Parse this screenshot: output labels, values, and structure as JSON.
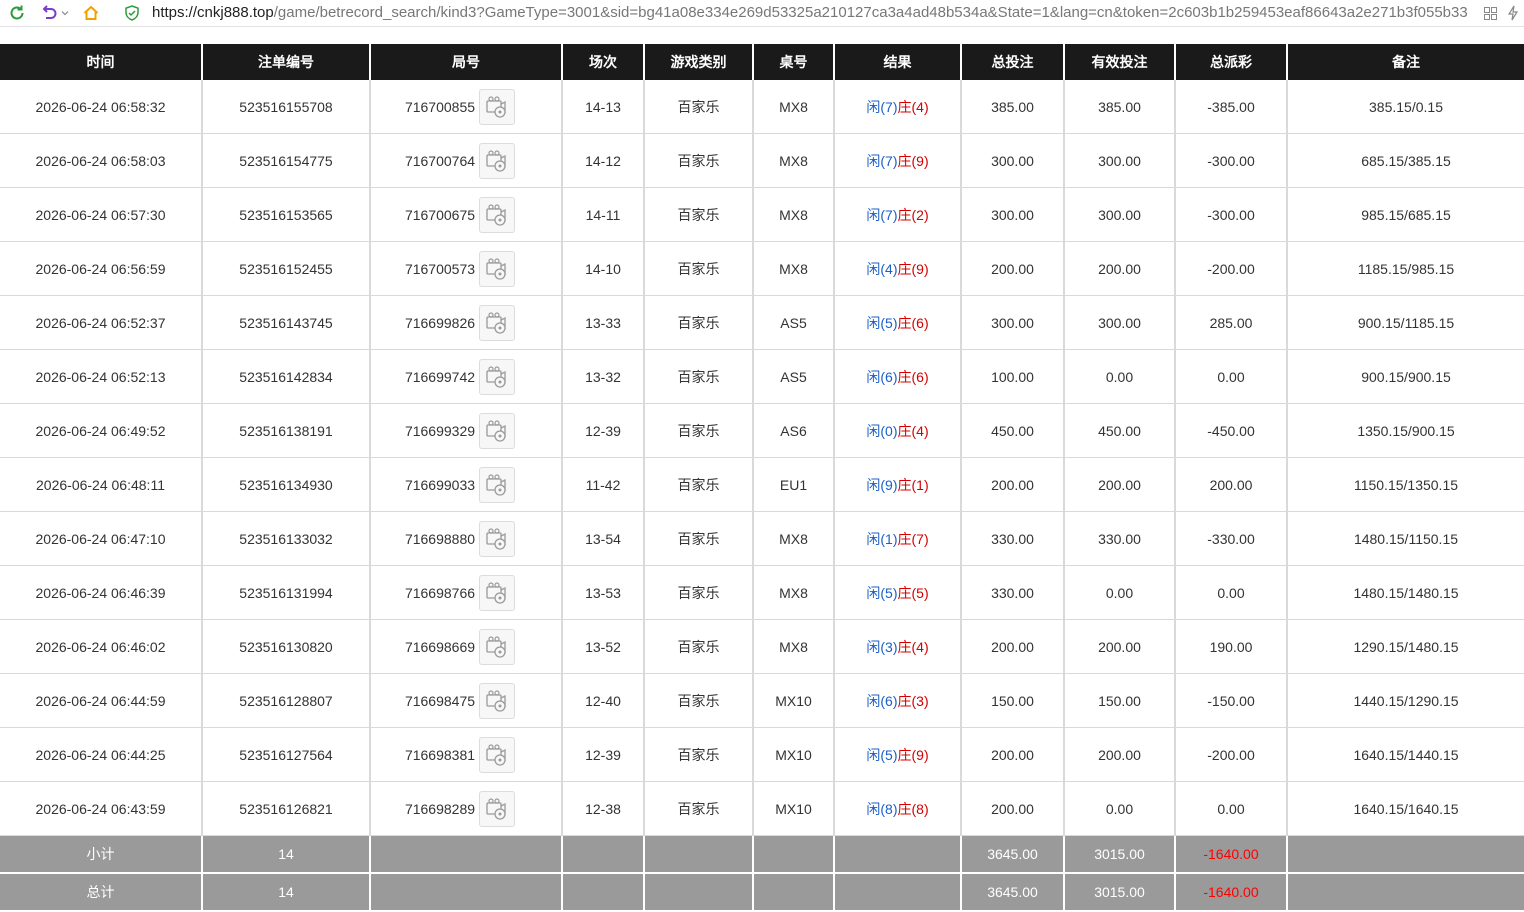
{
  "browser": {
    "url_host": "https://cnkj888.top",
    "url_path": "/game/betrecord_search/kind3?GameType=3001&sid=bg41a08e334e269d53325a210127ca3a4ad48b534a&State=1&lang=cn&token=2c603b1b259453eaf86643a2e271b3f055b33"
  },
  "colors": {
    "header_bg": "#1a1a1a",
    "sum_bg": "#9a9a9a",
    "player": "#1a5fc8",
    "banker": "#d40000",
    "negative": "#e60000"
  },
  "columns": [
    "时间",
    "注单编号",
    "局号",
    "场次",
    "游戏类别",
    "桌号",
    "结果",
    "总投注",
    "有效投注",
    "总派彩",
    "备注"
  ],
  "rows": [
    {
      "time": "2026-06-24 06:58:32",
      "bet_id": "523516155708",
      "round": "716700855",
      "session": "14-13",
      "game": "百家乐",
      "table": "MX8",
      "player": "闲(7)",
      "banker": "庄(4)",
      "total_bet": "385.00",
      "valid_bet": "385.00",
      "payout": "-385.00",
      "remark": "385.15/0.15"
    },
    {
      "time": "2026-06-24 06:58:03",
      "bet_id": "523516154775",
      "round": "716700764",
      "session": "14-12",
      "game": "百家乐",
      "table": "MX8",
      "player": "闲(7)",
      "banker": "庄(9)",
      "total_bet": "300.00",
      "valid_bet": "300.00",
      "payout": "-300.00",
      "remark": "685.15/385.15"
    },
    {
      "time": "2026-06-24 06:57:30",
      "bet_id": "523516153565",
      "round": "716700675",
      "session": "14-11",
      "game": "百家乐",
      "table": "MX8",
      "player": "闲(7)",
      "banker": "庄(2)",
      "total_bet": "300.00",
      "valid_bet": "300.00",
      "payout": "-300.00",
      "remark": "985.15/685.15"
    },
    {
      "time": "2026-06-24 06:56:59",
      "bet_id": "523516152455",
      "round": "716700573",
      "session": "14-10",
      "game": "百家乐",
      "table": "MX8",
      "player": "闲(4)",
      "banker": "庄(9)",
      "total_bet": "200.00",
      "valid_bet": "200.00",
      "payout": "-200.00",
      "remark": "1185.15/985.15"
    },
    {
      "time": "2026-06-24 06:52:37",
      "bet_id": "523516143745",
      "round": "716699826",
      "session": "13-33",
      "game": "百家乐",
      "table": "AS5",
      "player": "闲(5)",
      "banker": "庄(6)",
      "total_bet": "300.00",
      "valid_bet": "300.00",
      "payout": "285.00",
      "remark": "900.15/1185.15"
    },
    {
      "time": "2026-06-24 06:52:13",
      "bet_id": "523516142834",
      "round": "716699742",
      "session": "13-32",
      "game": "百家乐",
      "table": "AS5",
      "player": "闲(6)",
      "banker": "庄(6)",
      "total_bet": "100.00",
      "valid_bet": "0.00",
      "payout": "0.00",
      "remark": "900.15/900.15"
    },
    {
      "time": "2026-06-24 06:49:52",
      "bet_id": "523516138191",
      "round": "716699329",
      "session": "12-39",
      "game": "百家乐",
      "table": "AS6",
      "player": "闲(0)",
      "banker": "庄(4)",
      "total_bet": "450.00",
      "valid_bet": "450.00",
      "payout": "-450.00",
      "remark": "1350.15/900.15"
    },
    {
      "time": "2026-06-24 06:48:11",
      "bet_id": "523516134930",
      "round": "716699033",
      "session": "11-42",
      "game": "百家乐",
      "table": "EU1",
      "player": "闲(9)",
      "banker": "庄(1)",
      "total_bet": "200.00",
      "valid_bet": "200.00",
      "payout": "200.00",
      "remark": "1150.15/1350.15"
    },
    {
      "time": "2026-06-24 06:47:10",
      "bet_id": "523516133032",
      "round": "716698880",
      "session": "13-54",
      "game": "百家乐",
      "table": "MX8",
      "player": "闲(1)",
      "banker": "庄(7)",
      "total_bet": "330.00",
      "valid_bet": "330.00",
      "payout": "-330.00",
      "remark": "1480.15/1150.15"
    },
    {
      "time": "2026-06-24 06:46:39",
      "bet_id": "523516131994",
      "round": "716698766",
      "session": "13-53",
      "game": "百家乐",
      "table": "MX8",
      "player": "闲(5)",
      "banker": "庄(5)",
      "total_bet": "330.00",
      "valid_bet": "0.00",
      "payout": "0.00",
      "remark": "1480.15/1480.15"
    },
    {
      "time": "2026-06-24 06:46:02",
      "bet_id": "523516130820",
      "round": "716698669",
      "session": "13-52",
      "game": "百家乐",
      "table": "MX8",
      "player": "闲(3)",
      "banker": "庄(4)",
      "total_bet": "200.00",
      "valid_bet": "200.00",
      "payout": "190.00",
      "remark": "1290.15/1480.15"
    },
    {
      "time": "2026-06-24 06:44:59",
      "bet_id": "523516128807",
      "round": "716698475",
      "session": "12-40",
      "game": "百家乐",
      "table": "MX10",
      "player": "闲(6)",
      "banker": "庄(3)",
      "total_bet": "150.00",
      "valid_bet": "150.00",
      "payout": "-150.00",
      "remark": "1440.15/1290.15"
    },
    {
      "time": "2026-06-24 06:44:25",
      "bet_id": "523516127564",
      "round": "716698381",
      "session": "12-39",
      "game": "百家乐",
      "table": "MX10",
      "player": "闲(5)",
      "banker": "庄(9)",
      "total_bet": "200.00",
      "valid_bet": "200.00",
      "payout": "-200.00",
      "remark": "1640.15/1440.15"
    },
    {
      "time": "2026-06-24 06:43:59",
      "bet_id": "523516126821",
      "round": "716698289",
      "session": "12-38",
      "game": "百家乐",
      "table": "MX10",
      "player": "闲(8)",
      "banker": "庄(8)",
      "total_bet": "200.00",
      "valid_bet": "0.00",
      "payout": "0.00",
      "remark": "1640.15/1640.15"
    }
  ],
  "summary": [
    {
      "label": "小计",
      "count": "14",
      "total_bet": "3645.00",
      "valid_bet": "3015.00",
      "payout": "-1640.00"
    },
    {
      "label": "总计",
      "count": "14",
      "total_bet": "3645.00",
      "valid_bet": "3015.00",
      "payout": "-1640.00"
    }
  ]
}
